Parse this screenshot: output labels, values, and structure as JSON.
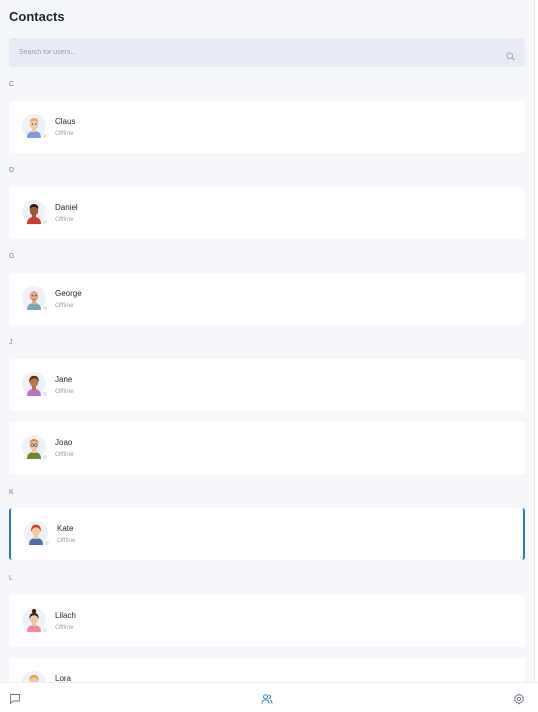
{
  "header": {
    "title": "Contacts"
  },
  "search": {
    "placeholder": "Search for users..."
  },
  "groups": [
    {
      "letter": "C",
      "contacts": [
        {
          "name": "Claus",
          "status": "Offline",
          "avatar": "avatar-claus"
        }
      ]
    },
    {
      "letter": "D",
      "contacts": [
        {
          "name": "Daniel",
          "status": "Offline",
          "avatar": "avatar-daniel"
        }
      ]
    },
    {
      "letter": "G",
      "contacts": [
        {
          "name": "George",
          "status": "Offline",
          "avatar": "avatar-george"
        }
      ]
    },
    {
      "letter": "J",
      "contacts": [
        {
          "name": "Jane",
          "status": "Offline",
          "avatar": "avatar-jane"
        },
        {
          "name": "Joao",
          "status": "Offline",
          "avatar": "avatar-joao"
        }
      ]
    },
    {
      "letter": "K",
      "contacts": [
        {
          "name": "Kate",
          "status": "Offline",
          "avatar": "avatar-kate",
          "selected": true
        }
      ]
    },
    {
      "letter": "L",
      "contacts": [
        {
          "name": "Lilach",
          "status": "Offline",
          "avatar": "avatar-lilach"
        },
        {
          "name": "Lora",
          "status": "",
          "avatar": "avatar-lora"
        }
      ]
    }
  ],
  "bottom_nav": {
    "items": [
      {
        "icon": "chat-icon",
        "active": false
      },
      {
        "icon": "users-icon",
        "active": true
      },
      {
        "icon": "gear-icon",
        "active": false
      }
    ]
  },
  "colors": {
    "accent": "#1e7bc6",
    "background": "#f5f7fb",
    "card": "#ffffff"
  }
}
